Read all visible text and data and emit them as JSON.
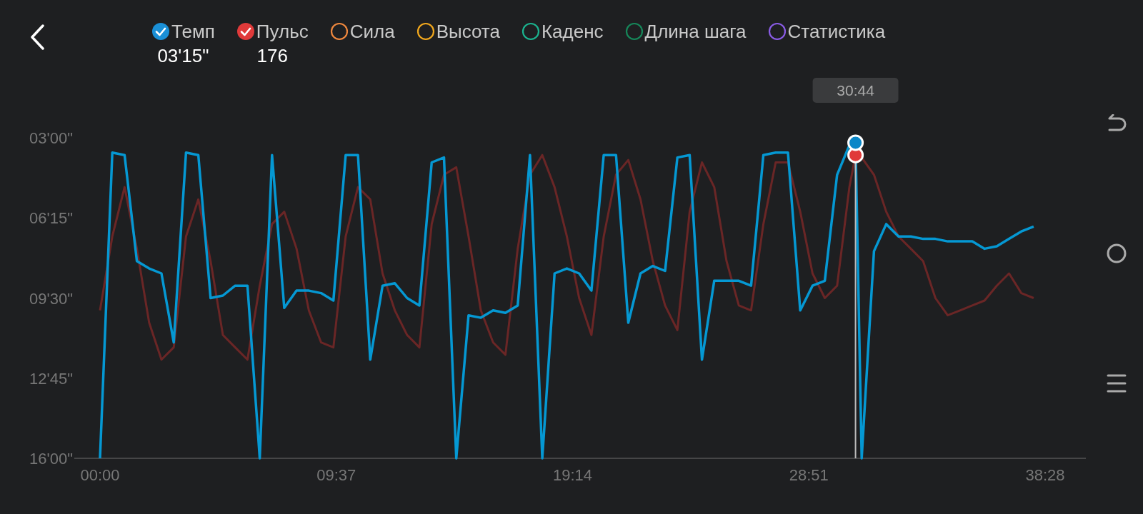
{
  "legend": [
    {
      "name": "Темп",
      "color": "#1a8fd6",
      "checked": true,
      "reading": "03'15\""
    },
    {
      "name": "Пульс",
      "color": "#e03a3a",
      "checked": true,
      "reading": "176"
    },
    {
      "name": "Сила",
      "color": "#f0883e",
      "checked": false
    },
    {
      "name": "Высота",
      "color": "#f2a81d",
      "checked": false
    },
    {
      "name": "Каденс",
      "color": "#1bb38f",
      "checked": false
    },
    {
      "name": "Длина шага",
      "color": "#16875a",
      "checked": false
    },
    {
      "name": "Статистика",
      "color": "#8a5ce6",
      "checked": false
    }
  ],
  "chart": {
    "y_labels": [
      "03'00\"",
      "06'15\"",
      "09'30\"",
      "12'45\"",
      "16'00\""
    ],
    "x_labels": [
      "00:00",
      "09:37",
      "19:14",
      "28:51",
      "38:28"
    ],
    "cursor_time": "30:44"
  }
}
